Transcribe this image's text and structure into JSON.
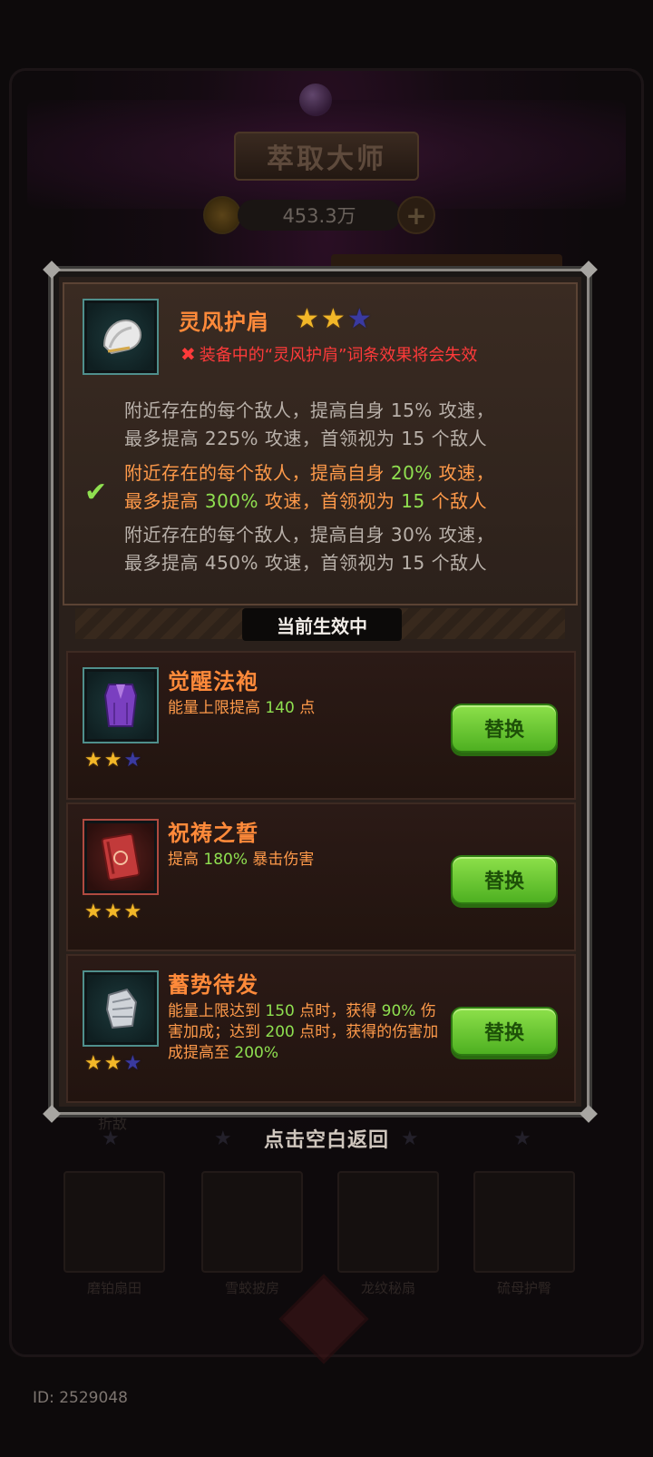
{
  "background": {
    "title": "萃取大师",
    "currency": "453.3万",
    "tap_to_return": "点击空白返回",
    "id_text": "ID: 2529048",
    "faded_label": "折敌",
    "slot_labels": [
      "磨铂扇田",
      "雪蛟披房",
      "龙纹秘扇",
      "硫母护臀"
    ]
  },
  "modal": {
    "current_item": {
      "name": "灵风护肩",
      "stars_filled": 2,
      "stars_total": 3,
      "warning": "装备中的“灵风护肩”词条效果将会失效",
      "tiers": [
        {
          "p1": "附近存在的每个敌人，提高自身 ",
          "v1": "15%",
          "p2": " 攻速，",
          "p3": "最多提高 ",
          "v2": "225%",
          "p4": " 攻速，首领视为 ",
          "v3": "15",
          "p5": " 个敌人",
          "active": false
        },
        {
          "p1": "附近存在的每个敌人，提高自身 ",
          "v1": "20%",
          "p2": " 攻速，",
          "p3": "最多提高 ",
          "v2": "300%",
          "p4": " 攻速，首领视为 ",
          "v3": "15",
          "p5": " 个敌人",
          "active": true
        },
        {
          "p1": "附近存在的每个敌人，提高自身 ",
          "v1": "30%",
          "p2": " 攻速，",
          "p3": "最多提高 ",
          "v2": "450%",
          "p4": " 攻速，首领视为 ",
          "v3": "15",
          "p5": " 个敌人",
          "active": false
        }
      ]
    },
    "section_label": "当前生效中",
    "replace_label": "替换",
    "equipped": [
      {
        "name": "觉醒法袍",
        "desc_a": "能量上限提高 ",
        "v1": "140",
        "desc_b": " 点",
        "stars_filled": 2
      },
      {
        "name": "祝祷之誓",
        "desc_a": "提高 ",
        "v1": "180%",
        "desc_b": " 暴击伤害",
        "stars_filled": 3
      },
      {
        "name": "蓄势待发",
        "desc_a": "能量上限达到 ",
        "v1": "150",
        "desc_b": " 点时，获得 ",
        "v2": "90%",
        "desc_c": " 伤害加成；达到 ",
        "v3": "200",
        "desc_d": " 点时，获得的伤害加成提高至 ",
        "v4": "200%",
        "stars_filled": 2
      }
    ]
  },
  "colors": {
    "name_orange": "#ff8a3a",
    "value_green": "#8fe050",
    "warning_red": "#ff3a3a",
    "button_green": "#6cc832"
  }
}
